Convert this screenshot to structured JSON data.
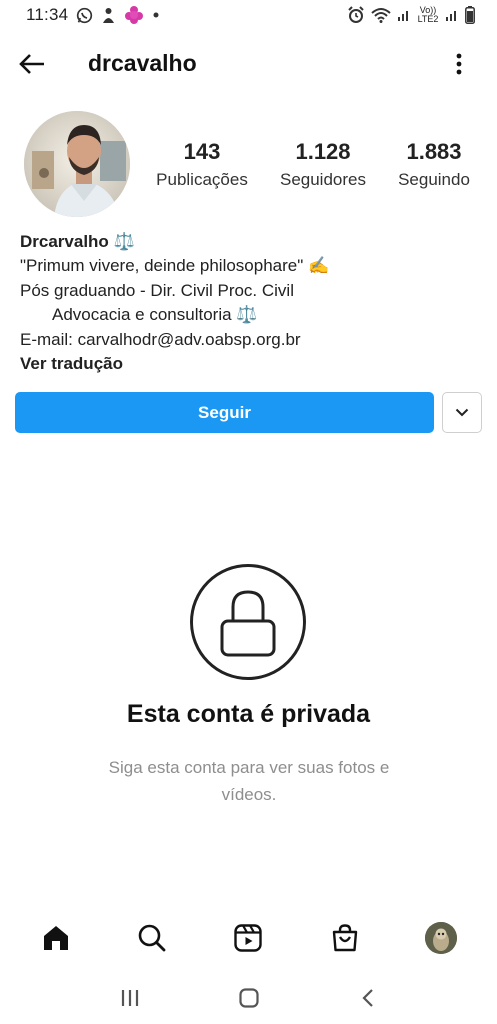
{
  "status_bar": {
    "time": "11:34",
    "network_label": "Vo)) LTE2",
    "icons": [
      "whatsapp-icon",
      "notification-icon",
      "app-icon",
      "dot-icon",
      "alarm-icon",
      "wifi-icon",
      "signal-icon",
      "battery-icon"
    ]
  },
  "header": {
    "username": "drcavalho",
    "back_icon": "arrow-left-icon",
    "more_icon": "vertical-dots-icon"
  },
  "profile": {
    "stats": [
      {
        "value": "143",
        "label": "Publicações"
      },
      {
        "value": "1.128",
        "label": "Seguidores"
      },
      {
        "value": "1.883",
        "label": "Seguindo"
      }
    ]
  },
  "bio": {
    "name": "Drcarvalho ⚖️",
    "line1": "\"Primum vivere, deinde philosophare\" ✍️",
    "line2": "Pós graduando - Dir. Civil Proc. Civil",
    "line3": "Advocacia e consultoria ⚖️",
    "line4": "E-mail: carvalhodr@adv.oabsp.org.br",
    "translate": "Ver tradução"
  },
  "actions": {
    "follow_label": "Seguir",
    "dropdown_icon": "chevron-down-icon",
    "primary_color": "#1a98f4"
  },
  "private": {
    "title": "Esta conta é privada",
    "description": "Siga esta conta para ver suas fotos e vídeos."
  },
  "bottom_nav": {
    "items": [
      "home-icon",
      "search-icon",
      "reels-icon",
      "shop-icon",
      "profile-avatar"
    ]
  },
  "android_nav": {
    "items": [
      "recent-apps-icon",
      "home-button-icon",
      "back-icon"
    ]
  }
}
